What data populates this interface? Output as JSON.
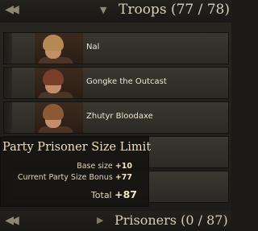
{
  "header": {
    "title": "Troops (77 / 78)",
    "collapse_icon": "double-chevron-left-icon",
    "toggle_icon": "triangle-down-icon"
  },
  "troops": [
    {
      "name": "Nal",
      "hair": "#b58a52"
    },
    {
      "name": "Gongke the Outcast",
      "hair": "#7a3f2a"
    },
    {
      "name": "Zhutyr Bloodaxe",
      "hair": "#8b5a34"
    }
  ],
  "tooltip": {
    "title": "Party Prisoner Size Limit",
    "base_label": "Base size",
    "base_value": "+10",
    "bonus_label": "Current Party Size Bonus",
    "bonus_value": "+77",
    "total_label": "Total",
    "total_value": "+87"
  },
  "footer": {
    "title": "Prisoners (0 / 87)",
    "collapse_icon": "double-chevron-left-icon",
    "toggle_icon": "triangle-right-icon"
  }
}
